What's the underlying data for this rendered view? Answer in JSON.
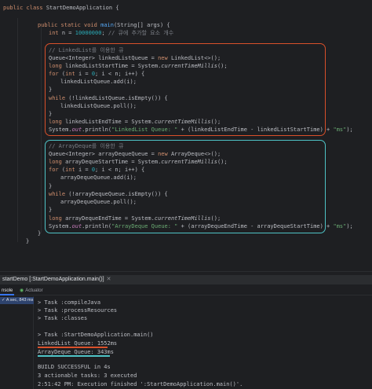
{
  "colors": {
    "background": "#1e1f22",
    "keyword": "#cf8e6d",
    "function": "#56a8f5",
    "number": "#2aacb8",
    "string": "#6aab73",
    "comment": "#7a7e85",
    "field": "#c77dbb",
    "highlight_linked": "#d9502a",
    "highlight_array": "#4fc3c6"
  },
  "editor": {
    "class_decl": {
      "kw1": "public",
      "kw2": "class",
      "name": "StartDemoApplication {"
    },
    "main_decl": {
      "kw1": "public",
      "kw2": "static",
      "kw3": "void",
      "fn": "main",
      "rest": "(String[] args) {"
    },
    "n_decl": {
      "kw": "int",
      "pre": "n = ",
      "num": "10000000",
      "post": ";",
      "comment": "// 큐에 추가할 요소 개수"
    },
    "linked": {
      "comment": "// LinkedList를 이용한 큐",
      "decl": {
        "pre": "Queue<Integer> linkedListQueue = ",
        "kw": "new",
        "post": "LinkedList<>();"
      },
      "start": {
        "kw": "long",
        "pre": "linkedListStartTime = System.",
        "method": "currentTimeMillis",
        "post": "();"
      },
      "for": {
        "kw1": "for",
        "a": "(",
        "kw2": "int",
        "b": "i = ",
        "n0": "0",
        "c": "; i < n; i++) {"
      },
      "add": "linkedListQueue.add(i);",
      "while": {
        "kw": "while",
        "rest": "(!linkedListQueue.isEmpty()) {"
      },
      "poll": "linkedListQueue.poll();",
      "end": {
        "kw": "long",
        "pre": "linkedListEndTime = System.",
        "method": "currentTimeMillis",
        "post": "();"
      },
      "print": {
        "a": "System.",
        "out": "out",
        "b": ".println(",
        "str": "\"LinkedList Queue: \"",
        "c": " + (linkedListEndTime - linkedListStartTime) + ",
        "ms": "\"ms\"",
        "d": ");"
      }
    },
    "array": {
      "comment": "// ArrayDeque를 이용한 큐",
      "decl": {
        "pre": "Queue<Integer> arrayDequeQueue = ",
        "kw": "new",
        "post": "ArrayDeque<>();"
      },
      "start": {
        "kw": "long",
        "pre": "arrayDequeStartTime = System.",
        "method": "currentTimeMillis",
        "post": "();"
      },
      "for": {
        "kw1": "for",
        "a": "(",
        "kw2": "int",
        "b": "i = ",
        "n0": "0",
        "c": "; i < n; i++) {"
      },
      "add": "arrayDequeQueue.add(i);",
      "while": {
        "kw": "while",
        "rest": "(!arrayDequeQueue.isEmpty()) {"
      },
      "poll": "arrayDequeQueue.poll();",
      "end": {
        "kw": "long",
        "pre": "arrayDequeEndTime = System.",
        "method": "currentTimeMillis",
        "post": "();"
      },
      "print": {
        "a": "System.",
        "out": "out",
        "b": ".println(",
        "str": "\"ArrayDeque Queue: \"",
        "c": " + (arrayDequeEndTime - arrayDequeStartTime) + ",
        "ms": "\"ms\"",
        "d": ");"
      }
    },
    "brace": "}"
  },
  "run_panel": {
    "tab_label": "StartDemoApplication.main()",
    "tab_prefix": "startDemo [:",
    "tab_suffix": "]",
    "subtabs": {
      "console": "nsole",
      "actuator": "Actuator"
    },
    "tree_item": "✓ A sec, 843 ms",
    "output": [
      "> Task :compileJava",
      "> Task :processResources",
      "> Task :classes",
      "",
      "> Task :StartDemoApplication.main()",
      "LinkedList Queue: 1552ms",
      "ArrayDeque Queue: 343ms",
      "",
      "BUILD SUCCESSFUL in 4s",
      "3 actionable tasks: 3 executed",
      "2:51:42 PM: Execution finished ':StartDemoApplication.main()'."
    ]
  }
}
